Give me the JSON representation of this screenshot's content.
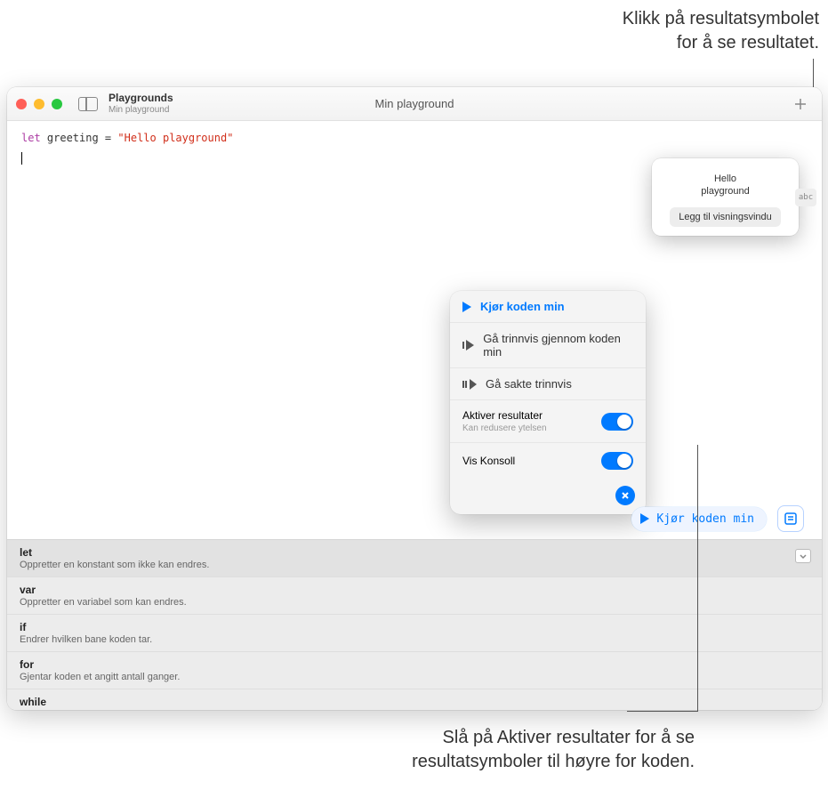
{
  "callouts": {
    "top_line1": "Klikk på resultatsymbolet",
    "top_line2": "for å se resultatet.",
    "bottom_line1": "Slå på Aktiver resultater for å se",
    "bottom_line2": "resultatsymboler til høyre for koden."
  },
  "titlebar": {
    "app": "Playgrounds",
    "subtitle": "Min playground",
    "windowTitle": "Min playground"
  },
  "code": {
    "kw": "let",
    "ident": " greeting = ",
    "str": "\"Hello playground\""
  },
  "resultPopover": {
    "line1": "Hello",
    "line2": "playground",
    "button": "Legg til visningsvindu"
  },
  "resultGutter": {
    "label": "abc"
  },
  "runPopover": {
    "run": "Kjør koden min",
    "step": "Gå trinnvis gjennom koden min",
    "stepSlow": "Gå sakte trinnvis",
    "toggleResults": "Aktiver resultater",
    "toggleResultsSub": "Kan redusere ytelsen",
    "toggleConsole": "Vis Konsoll"
  },
  "runBar": {
    "run": "Kjør koden min"
  },
  "suggestions": [
    {
      "title": "let",
      "desc": "Oppretter en konstant som ikke kan endres."
    },
    {
      "title": "var",
      "desc": "Oppretter en variabel som kan endres."
    },
    {
      "title": "if",
      "desc": "Endrer hvilken bane koden tar."
    },
    {
      "title": "for",
      "desc": "Gjentar koden et angitt antall ganger."
    },
    {
      "title": "while",
      "desc": ""
    }
  ]
}
